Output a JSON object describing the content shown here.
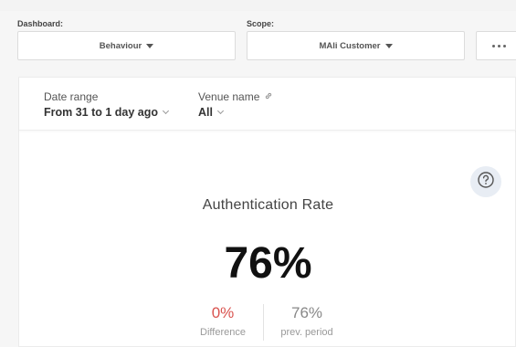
{
  "selectors": {
    "dashboard": {
      "label": "Dashboard:",
      "value": "Behaviour"
    },
    "scope": {
      "label": "Scope:",
      "value": "MAli Customer"
    }
  },
  "filters": {
    "date_range": {
      "label": "Date range",
      "value": "From 31 to 1 day ago"
    },
    "venue_name": {
      "label": "Venue name",
      "value": "All"
    }
  },
  "metric": {
    "title": "Authentication Rate",
    "value": "76%",
    "difference": {
      "value": "0%",
      "label": "Difference",
      "color": "#d9534f"
    },
    "previous": {
      "value": "76%",
      "label": "prev. period",
      "color": "#888888"
    }
  },
  "icons": {
    "help": "help-circle-icon",
    "link": "link-icon",
    "more": "more-horizontal-icon"
  }
}
